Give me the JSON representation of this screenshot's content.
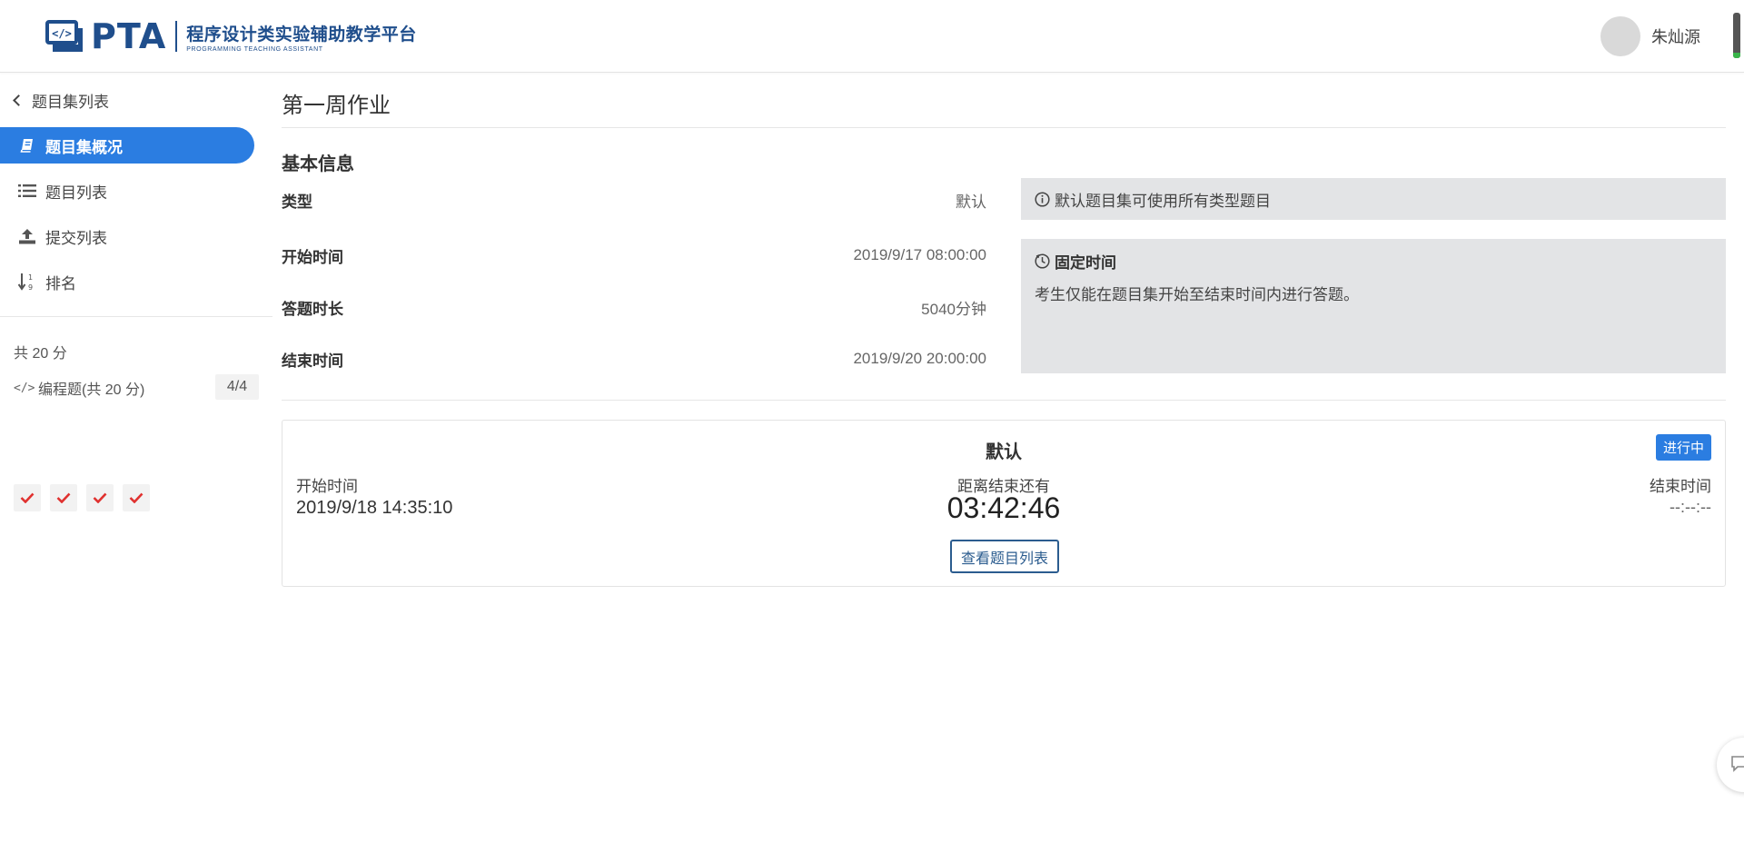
{
  "header": {
    "logo_text": "PTA",
    "logo_subtitle_cn": "程序设计类实验辅助教学平台",
    "logo_subtitle_en": "PROGRAMMING TEACHING ASSISTANT",
    "user_name": "朱灿源"
  },
  "sidebar": {
    "back_label": "题目集列表",
    "items": [
      {
        "label": "题目集概况",
        "icon": "book-icon",
        "active": true
      },
      {
        "label": "题目列表",
        "icon": "list-icon",
        "active": false
      },
      {
        "label": "提交列表",
        "icon": "upload-icon",
        "active": false
      },
      {
        "label": "排名",
        "icon": "sort-numeric-icon",
        "active": false
      }
    ],
    "score_total": "共 20 分",
    "category": {
      "label": "编程题(共 20 分)",
      "icon": "code-icon",
      "count": "4/4"
    },
    "problem_status": [
      "solved",
      "solved",
      "solved",
      "solved"
    ]
  },
  "main": {
    "page_title": "第一周作业",
    "section_title": "基本信息",
    "info": {
      "type_label": "类型",
      "type_value": "默认",
      "start_label": "开始时间",
      "start_value": "2019/9/17 08:00:00",
      "duration_label": "答题时长",
      "duration_value": "5040分钟",
      "end_label": "结束时间",
      "end_value": "2019/9/20 20:00:00"
    },
    "notice_type": "默认题目集可使用所有类型题目",
    "notice_time_title": "固定时间",
    "notice_time_body": "考生仅能在题目集开始至结束时间内进行答题。"
  },
  "card": {
    "title": "默认",
    "status_badge": "进行中",
    "start_label": "开始时间",
    "start_value": "2019/9/18 14:35:10",
    "remaining_label": "距离结束还有",
    "countdown": "03:42:46",
    "end_label": "结束时间",
    "end_value": "--:--:--",
    "view_button": "查看题目列表"
  },
  "colors": {
    "brand": "#1f4e8c",
    "accent": "#2b7de1",
    "check": "#e0312f",
    "notice_bg": "#e3e4e6"
  }
}
